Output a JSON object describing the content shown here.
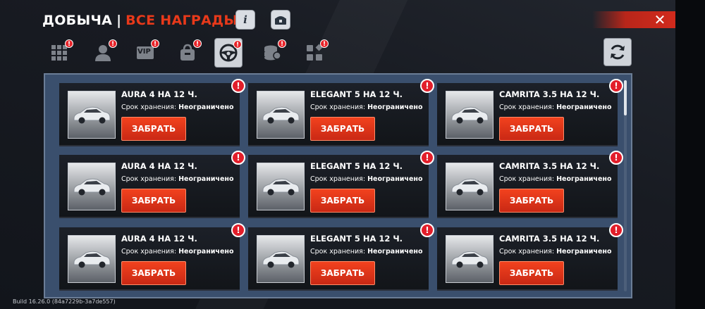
{
  "header": {
    "title": "ДОБЫЧА",
    "separator": "|",
    "subtitle": "ВСЕ НАГРАДЫ",
    "info_icon_glyph": "i",
    "accent": "#e8391a"
  },
  "tabs": [
    {
      "name": "grid-icon",
      "badge": "!",
      "active": false
    },
    {
      "name": "user-icon",
      "badge": "!",
      "active": false
    },
    {
      "name": "vip-icon",
      "badge": "!",
      "label": "VIP",
      "active": false
    },
    {
      "name": "bag-icon",
      "badge": "!",
      "active": false
    },
    {
      "name": "steering-wheel-icon",
      "badge": "!",
      "active": true
    },
    {
      "name": "coins-icon",
      "badge": "!",
      "active": false
    },
    {
      "name": "apps-icon",
      "badge": "!",
      "active": false
    }
  ],
  "cards": [
    {
      "title": "AURA 4 НА 12 Ч.",
      "storage_label": "Срок хранения:",
      "storage_value": "Неограничено",
      "button": "ЗАБРАТЬ",
      "alert": "!"
    },
    {
      "title": "ELEGANT 5 НА 12 Ч.",
      "storage_label": "Срок хранения:",
      "storage_value": "Неограничено",
      "button": "ЗАБРАТЬ",
      "alert": "!"
    },
    {
      "title": "CAMRITA 3.5 НА 12 Ч.",
      "storage_label": "Срок хранения:",
      "storage_value": "Неограничено",
      "button": "ЗАБРАТЬ",
      "alert": "!"
    },
    {
      "title": "AURA 4 НА 12 Ч.",
      "storage_label": "Срок хранения:",
      "storage_value": "Неограничено",
      "button": "ЗАБРАТЬ",
      "alert": "!"
    },
    {
      "title": "ELEGANT 5 НА 12 Ч.",
      "storage_label": "Срок хранения:",
      "storage_value": "Неограничено",
      "button": "ЗАБРАТЬ",
      "alert": "!"
    },
    {
      "title": "CAMRITA 3.5 НА 12 Ч.",
      "storage_label": "Срок хранения:",
      "storage_value": "Неограничено",
      "button": "ЗАБРАТЬ",
      "alert": "!"
    },
    {
      "title": "AURA 4 НА 12 Ч.",
      "storage_label": "Срок хранения:",
      "storage_value": "Неограничено",
      "button": "ЗАБРАТЬ",
      "alert": "!"
    },
    {
      "title": "ELEGANT 5 НА 12 Ч.",
      "storage_label": "Срок хранения:",
      "storage_value": "Неограничено",
      "button": "ЗАБРАТЬ",
      "alert": "!"
    },
    {
      "title": "CAMRITA 3.5 НА 12 Ч.",
      "storage_label": "Срок хранения:",
      "storage_value": "Неограничено",
      "button": "ЗАБРАТЬ",
      "alert": "!"
    }
  ],
  "footer": {
    "build": "Build 16.26.0 (84a7229b-3a7de557)"
  },
  "colors": {
    "claim_button": "#e0331a",
    "alert_badge": "#e21e2a",
    "panel_bg": "#3a4f6d"
  }
}
